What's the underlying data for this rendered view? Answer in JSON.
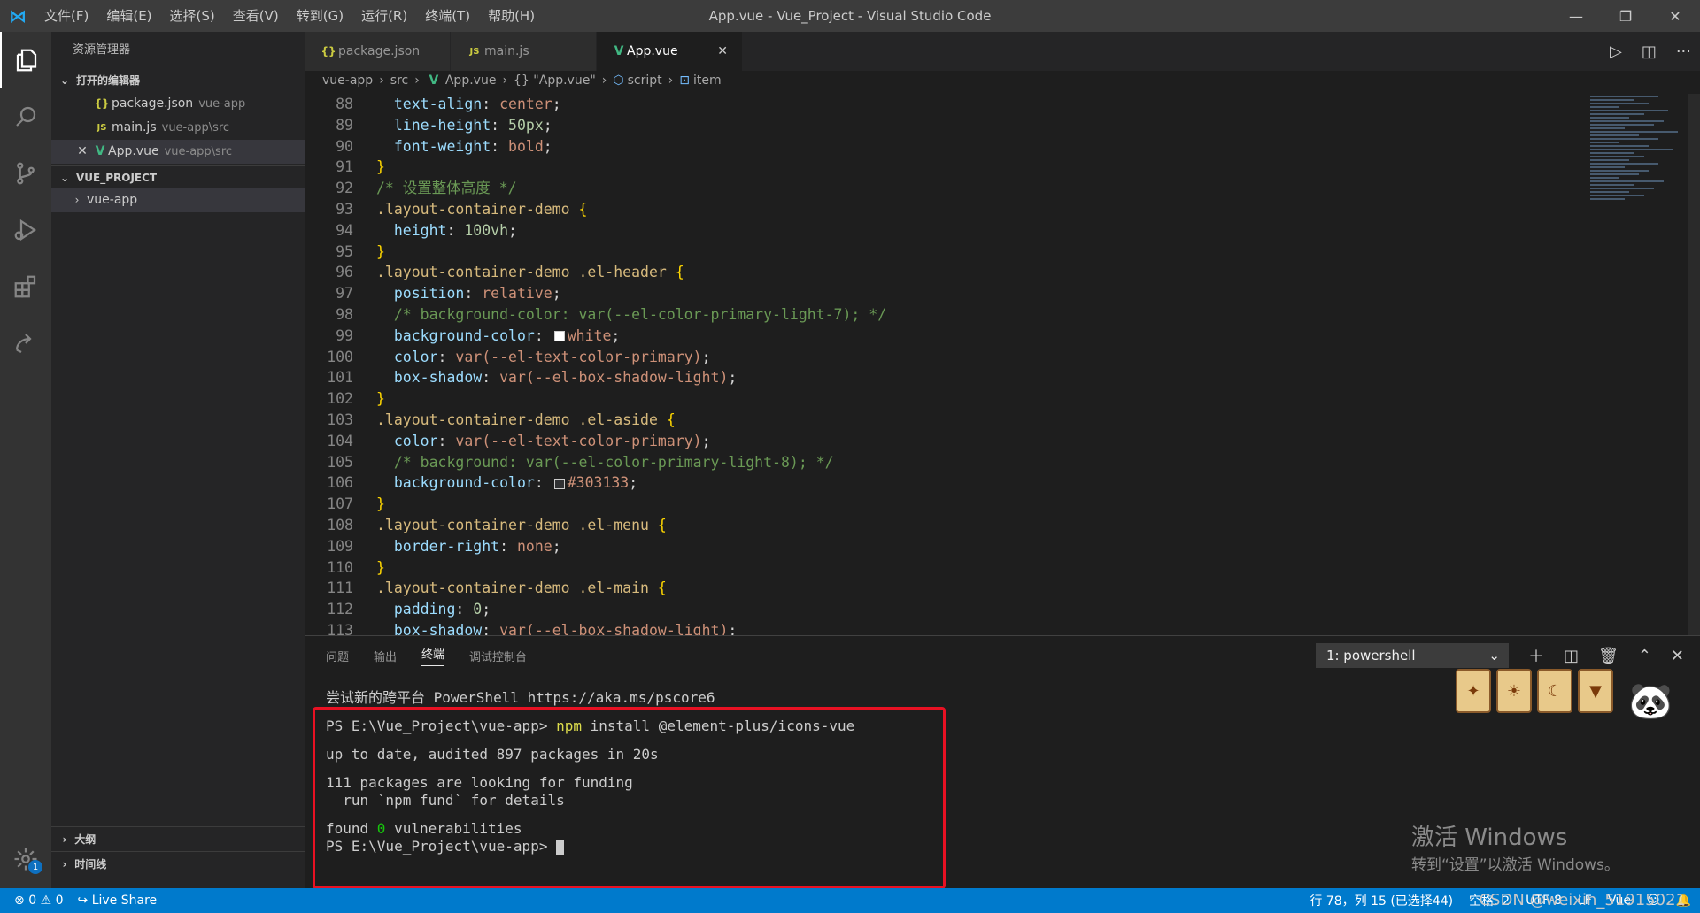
{
  "window": {
    "title": "App.vue - Vue_Project - Visual Studio Code",
    "menu": [
      "文件(F)",
      "编辑(E)",
      "选择(S)",
      "查看(V)",
      "转到(G)",
      "运行(R)",
      "终端(T)",
      "帮助(H)"
    ]
  },
  "sidebar": {
    "title": "资源管理器",
    "open_editors": "打开的编辑器",
    "open_files": [
      {
        "name": "package.json",
        "path": "vue-app"
      },
      {
        "name": "main.js",
        "path": "vue-app\\src"
      },
      {
        "name": "App.vue",
        "path": "vue-app\\src"
      }
    ],
    "project": "VUE_PROJECT",
    "folder": "vue-app",
    "outline": "大纲",
    "timeline": "时间线",
    "settings_badge": "1"
  },
  "tabs": [
    "package.json",
    "main.js",
    "App.vue"
  ],
  "breadcrumb": [
    "vue-app",
    "src",
    "App.vue",
    "{} \"App.vue\"",
    "script",
    "item"
  ],
  "code": {
    "lines": [
      {
        "n": "88",
        "prop": "text-align",
        "val": "center"
      },
      {
        "n": "89",
        "prop": "line-height",
        "val": "50px"
      },
      {
        "n": "90",
        "prop": "font-weight",
        "val": "bold"
      },
      {
        "n": "91",
        "close": "}"
      },
      {
        "n": "92",
        "comment": "/* 设置整体高度 */"
      },
      {
        "n": "93",
        "selector": ".layout-container-demo {"
      },
      {
        "n": "94",
        "prop": "height",
        "val": "100vh"
      },
      {
        "n": "95",
        "close": "}"
      },
      {
        "n": "96",
        "selector": ".layout-container-demo .el-header {"
      },
      {
        "n": "97",
        "prop": "position",
        "val": "relative"
      },
      {
        "n": "98",
        "comment": "  /* background-color: var(--el-color-primary-light-7); */"
      },
      {
        "n": "99",
        "prop": "background-color",
        "val": "white",
        "swatch": "#ffffff"
      },
      {
        "n": "100",
        "prop": "color",
        "val": "var(--el-text-color-primary)"
      },
      {
        "n": "101",
        "prop": "box-shadow",
        "val": "var(--el-box-shadow-light)"
      },
      {
        "n": "102",
        "close": "}"
      },
      {
        "n": "103",
        "selector": ".layout-container-demo .el-aside {"
      },
      {
        "n": "104",
        "prop": "color",
        "val": "var(--el-text-color-primary)"
      },
      {
        "n": "105",
        "comment": "  /* background: var(--el-color-primary-light-8); */"
      },
      {
        "n": "106",
        "prop": "background-color",
        "val": "#303133",
        "swatch": "#303133"
      },
      {
        "n": "107",
        "close": "}"
      },
      {
        "n": "108",
        "selector": ".layout-container-demo .el-menu {"
      },
      {
        "n": "109",
        "prop": "border-right",
        "val": "none"
      },
      {
        "n": "110",
        "close": "}"
      },
      {
        "n": "111",
        "selector": ".layout-container-demo .el-main {"
      },
      {
        "n": "112",
        "prop": "padding",
        "val": "0"
      },
      {
        "n": "113",
        "prop": "box-shadow",
        "val": "var(--el-box-shadow-light)"
      }
    ]
  },
  "panel": {
    "tabs": [
      "问题",
      "输出",
      "终端",
      "调试控制台"
    ],
    "active_tab": "终端",
    "terminal_select": "1: powershell",
    "terminal": {
      "l1": "尝试新的跨平台 PowerShell https://aka.ms/pscore6",
      "prompt": "PS E:\\Vue_Project\\vue-app>",
      "cmd_npm": "npm",
      "cmd_rest": " install @element-plus/icons-vue",
      "l3": "up to date, audited 897 packages in 20s",
      "l4": "111 packages are looking for funding",
      "l5": "  run `npm fund` for details",
      "found": "found ",
      "zero": "0",
      "vuln": " vulnerabilities"
    }
  },
  "watermark": {
    "line1": "激活 Windows",
    "line2": "转到“设置”以激活 Windows。"
  },
  "statusbar": {
    "errors": "0",
    "warnings": "0",
    "live_share": "Live Share",
    "position": "行 78，列 15 (已选择44)",
    "spaces": "空格: 2",
    "encoding": "UTF-8",
    "eol": "LF",
    "lang": "Vue"
  },
  "csdn": "CSDN @weixin_51915021",
  "colors": {
    "accent": "#007acc",
    "highlight_box": "#e81123"
  }
}
